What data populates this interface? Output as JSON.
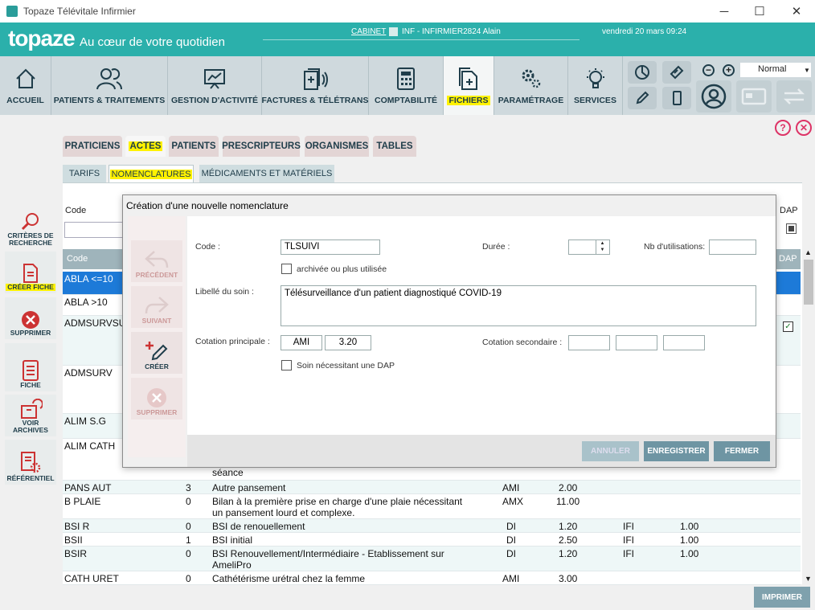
{
  "window": {
    "title": "Topaze Télévitale Infirmier",
    "minimize": "─",
    "maximize": "☐",
    "close": "✕"
  },
  "banner": {
    "logo": "topaze",
    "slogan": "Au cœur de votre quotidien",
    "cabinet": "CABINET",
    "user": "INF - INFIRMIER2824 Alain",
    "date": "vendredi 20 mars 09:24"
  },
  "toolbar": {
    "buttons": [
      "ACCUEIL",
      "PATIENTS & TRAITEMENTS",
      "GESTION D'ACTIVITÉ",
      "FACTURES & TÉLÉTRANS",
      "COMPTABILITÉ",
      "FICHIERS",
      "PARAMÉTRAGE",
      "SERVICES"
    ],
    "active": "FICHIERS",
    "zoom_mode": "Normal"
  },
  "help": {
    "help_icon": "?",
    "close_icon": "✕"
  },
  "sidebar": {
    "items": [
      "CRITÈRES DE RECHERCHE",
      "CRÉER FICHE",
      "SUPPRIMER",
      "FICHE",
      "VOIR ARCHIVES",
      "RÉFÉRENTIEL"
    ]
  },
  "tabs1": [
    "PRATICIENS",
    "ACTES",
    "PATIENTS",
    "PRESCRIPTEURS",
    "ORGANISMES",
    "TABLES"
  ],
  "tabs2": [
    "TARIFS",
    "NOMENCLATURES",
    "MÉDICAMENTS ET MATÉRIELS"
  ],
  "grid": {
    "search_label": "Code",
    "dap_label": "DAP",
    "header_code": "Code",
    "header_dap": "DAP",
    "rows": [
      {
        "code": "ABLA <=10"
      },
      {
        "code": "ABLA >10"
      },
      {
        "code": "ADMSURVSU"
      },
      {
        "code": "ADMSURV"
      },
      {
        "code": "ALIM S.G"
      },
      {
        "code": "ALIM CATH",
        "desc": "séance"
      },
      {
        "code": "PANS AUT",
        "n": "3",
        "desc": "Autre pansement",
        "c1": "AMI",
        "v1": "2.00",
        "c2": "",
        "v2": ""
      },
      {
        "code": "B PLAIE",
        "n": "0",
        "desc": "Bilan à la première prise en charge d'une plaie nécessitant",
        "desc2": "un pansement lourd et complexe.",
        "c1": "AMX",
        "v1": "11.00",
        "c2": "",
        "v2": ""
      },
      {
        "code": "BSI R",
        "n": "0",
        "desc": "BSI de renouellement",
        "c1": "DI",
        "v1": "1.20",
        "c2": "IFI",
        "v2": "1.00"
      },
      {
        "code": "BSII",
        "n": "1",
        "desc": "BSI initial",
        "c1": "DI",
        "v1": "2.50",
        "c2": "IFI",
        "v2": "1.00"
      },
      {
        "code": "BSIR",
        "n": "0",
        "desc": "BSI Renouvellement/Intermédiaire - Etablissement sur",
        "desc2": "AmeliPro",
        "c1": "DI",
        "v1": "1.20",
        "c2": "IFI",
        "v2": "1.00"
      },
      {
        "code": "CATH URET",
        "n": "0",
        "desc": "Cathétérisme urétral chez la femme",
        "c1": "AMI",
        "v1": "3.00",
        "c2": "",
        "v2": ""
      }
    ]
  },
  "imprimer": "IMPRIMER",
  "dialog": {
    "title": "Création d'une nouvelle nomenclature",
    "side": [
      "PRÉCÉDENT",
      "SUIVANT",
      "CRÉER",
      "SUPPRIMER"
    ],
    "code_label": "Code :",
    "code_value": "TLSUIVI",
    "archive_label": "archivée ou plus utilisée",
    "duree_label": "Durée :",
    "duree_value": "",
    "nb_label": "Nb d'utilisations:",
    "nb_value": "",
    "libelle_label": "Libellé du soin :",
    "libelle_value": "Télésurveillance d'un patient diagnostiqué COVID-19",
    "cot_label": "Cotation principale :",
    "cot_key": "AMI",
    "cot_val": "3.20",
    "cot2_label": "Cotation secondaire :",
    "dap_label": "Soin nécessitant une DAP",
    "buttons": [
      "ANNULER",
      "ENREGISTRER",
      "FERMER"
    ]
  }
}
